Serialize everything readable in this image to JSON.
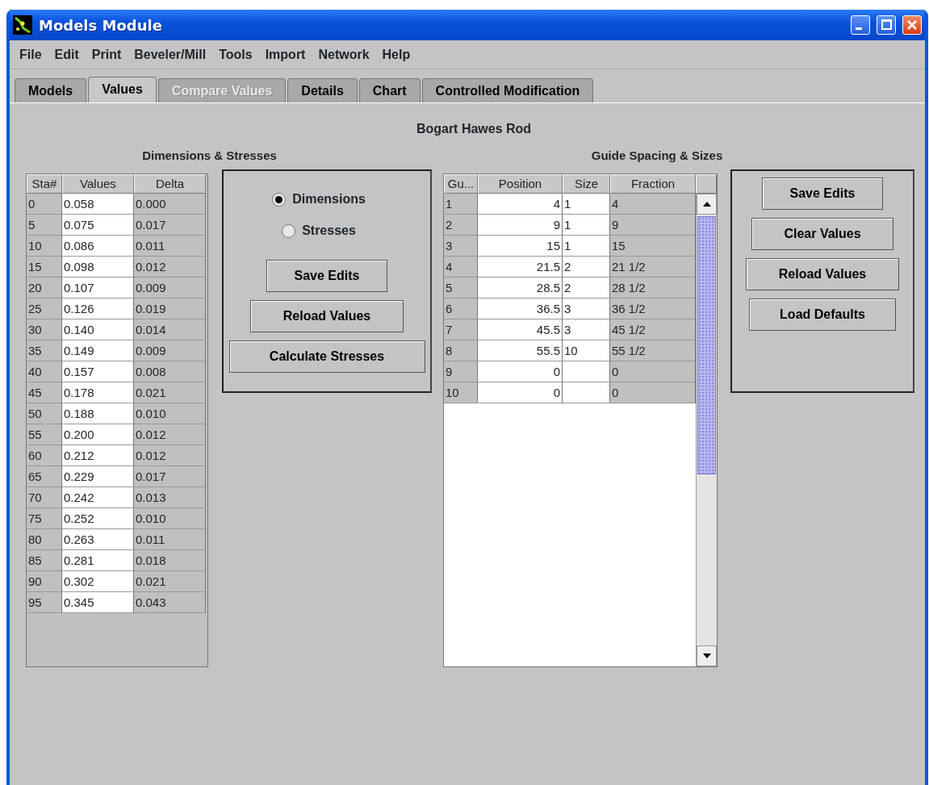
{
  "window": {
    "title": "Models Module"
  },
  "menu": [
    "File",
    "Edit",
    "Print",
    "Beveler/Mill",
    "Tools",
    "Import",
    "Network",
    "Help"
  ],
  "tabs": [
    {
      "label": "Models",
      "selected": false,
      "disabled": false
    },
    {
      "label": "Values",
      "selected": true,
      "disabled": false
    },
    {
      "label": "Compare Values",
      "selected": false,
      "disabled": true
    },
    {
      "label": "Details",
      "selected": false,
      "disabled": false
    },
    {
      "label": "Chart",
      "selected": false,
      "disabled": false
    },
    {
      "label": "Controlled Modification",
      "selected": false,
      "disabled": false
    }
  ],
  "heading": "Bogart Hawes Rod",
  "dimensions": {
    "title": "Dimensions & Stresses",
    "columns": [
      "Sta#",
      "Values",
      "Delta"
    ],
    "rows": [
      [
        "0",
        "0.058",
        "0.000"
      ],
      [
        "5",
        "0.075",
        "0.017"
      ],
      [
        "10",
        "0.086",
        "0.011"
      ],
      [
        "15",
        "0.098",
        "0.012"
      ],
      [
        "20",
        "0.107",
        "0.009"
      ],
      [
        "25",
        "0.126",
        "0.019"
      ],
      [
        "30",
        "0.140",
        "0.014"
      ],
      [
        "35",
        "0.149",
        "0.009"
      ],
      [
        "40",
        "0.157",
        "0.008"
      ],
      [
        "45",
        "0.178",
        "0.021"
      ],
      [
        "50",
        "0.188",
        "0.010"
      ],
      [
        "55",
        "0.200",
        "0.012"
      ],
      [
        "60",
        "0.212",
        "0.012"
      ],
      [
        "65",
        "0.229",
        "0.017"
      ],
      [
        "70",
        "0.242",
        "0.013"
      ],
      [
        "75",
        "0.252",
        "0.010"
      ],
      [
        "80",
        "0.263",
        "0.011"
      ],
      [
        "85",
        "0.281",
        "0.018"
      ],
      [
        "90",
        "0.302",
        "0.021"
      ],
      [
        "95",
        "0.345",
        "0.043"
      ]
    ],
    "options": [
      {
        "label": "Dimensions",
        "selected": true
      },
      {
        "label": "Stresses",
        "selected": false
      }
    ],
    "buttons": [
      "Save Edits",
      "Reload Values",
      "Calculate Stresses"
    ]
  },
  "guides": {
    "title": "Guide Spacing & Sizes",
    "columns": [
      "Gu...",
      "Position",
      "Size",
      "Fraction"
    ],
    "rows": [
      [
        "1",
        "4",
        "1",
        "4"
      ],
      [
        "2",
        "9",
        "1",
        "9"
      ],
      [
        "3",
        "15",
        "1",
        "15"
      ],
      [
        "4",
        "21.5",
        "2",
        "21 1/2"
      ],
      [
        "5",
        "28.5",
        "2",
        "28 1/2"
      ],
      [
        "6",
        "36.5",
        "3",
        "36 1/2"
      ],
      [
        "7",
        "45.5",
        "3",
        "45 1/2"
      ],
      [
        "8",
        "55.5",
        "10",
        "55 1/2"
      ],
      [
        "9",
        "0",
        "",
        "0"
      ],
      [
        "10",
        "0",
        "",
        "0"
      ]
    ],
    "buttons": [
      "Save Edits",
      "Clear Values",
      "Reload Values",
      "Load Defaults"
    ]
  }
}
